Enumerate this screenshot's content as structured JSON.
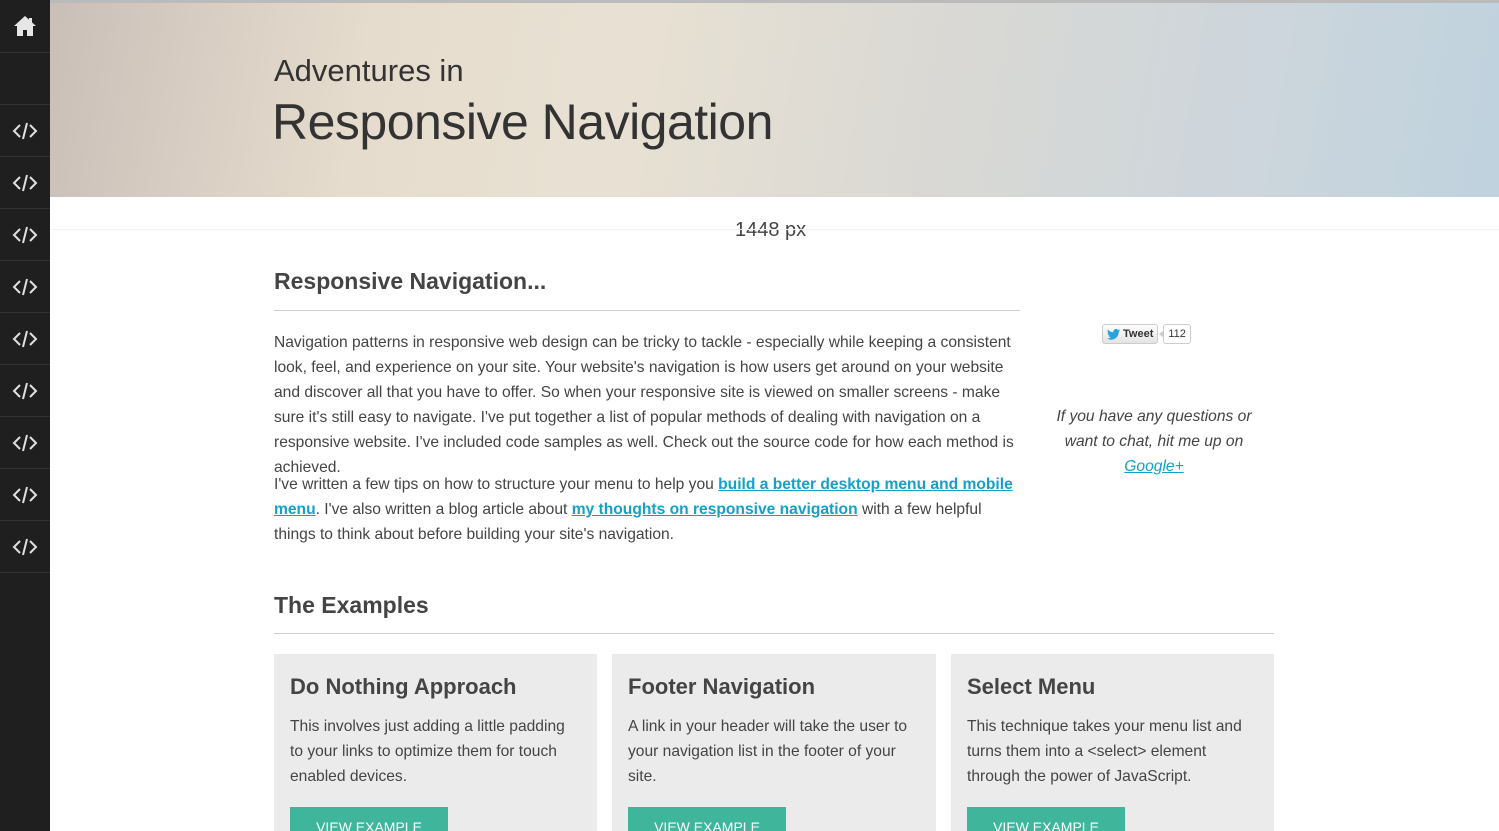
{
  "sidebar": {
    "home_icon": "home-icon",
    "code_icon": "code-icon",
    "code_buttons": 9
  },
  "header": {
    "subtitle": "Adventures in",
    "title": "Responsive Navigation"
  },
  "width_readout": "1448 px",
  "intro": {
    "heading": "Responsive Navigation...",
    "paragraph1": "Navigation patterns in responsive web design can be tricky to tackle - especially while keeping a consistent look, feel, and experience on your site. Your website's navigation is how users get around on your website and discover all that you have to offer. So when your responsive site is viewed on smaller screens - make sure it's still easy to navigate. I've put together a list of popular methods of dealing with navigation on a responsive website. I've included code samples as well. Check out the source code for how each method is achieved.",
    "p2_part1": "I've written a few tips on how to structure your menu to help you ",
    "p2_link1": "build a better desktop menu and mobile menu",
    "p2_part2": ". I've also written a blog article about ",
    "p2_link2": "my thoughts on responsive navigation",
    "p2_part3": " with a few helpful things to think about before building your site's navigation."
  },
  "tweet": {
    "label": "Tweet",
    "count": "112"
  },
  "aside": {
    "text": "If you have any questions or want to chat, hit me up on",
    "link": "Google+"
  },
  "examples": {
    "heading": "The Examples",
    "cards": [
      {
        "title": "Do Nothing Approach",
        "text": "This involves just adding a little padding to your links to optimize them for touch enabled devices.",
        "button": "VIEW EXAMPLE"
      },
      {
        "title": "Footer Navigation",
        "text": "A link in your header will take the user to your navigation list in the footer of your site.",
        "button": "VIEW EXAMPLE"
      },
      {
        "title": "Select Menu",
        "text": "This technique takes your menu list and turns them into a <select> element through the power of JavaScript.",
        "button": "VIEW EXAMPLE"
      }
    ]
  },
  "colors": {
    "accent": "#3fb59b",
    "link": "#14a0c8",
    "sidebar": "#1f1f1f"
  }
}
